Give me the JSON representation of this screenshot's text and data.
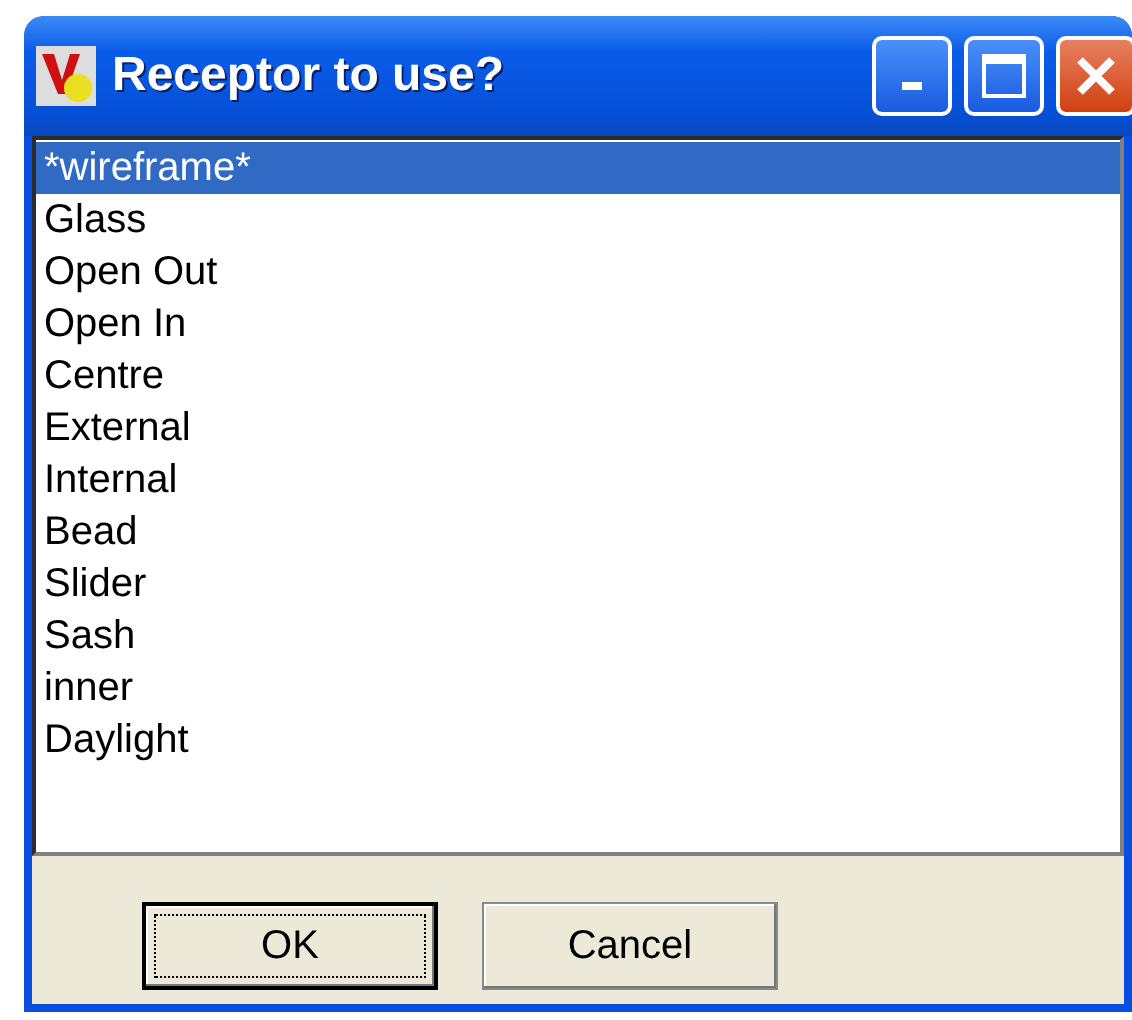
{
  "window": {
    "title": "Receptor to use?"
  },
  "list": {
    "items": [
      {
        "label": "*wireframe*",
        "selected": true
      },
      {
        "label": "Glass",
        "selected": false
      },
      {
        "label": "Open Out",
        "selected": false
      },
      {
        "label": "Open In",
        "selected": false
      },
      {
        "label": "Centre",
        "selected": false
      },
      {
        "label": "External",
        "selected": false
      },
      {
        "label": "Internal",
        "selected": false
      },
      {
        "label": "Bead",
        "selected": false
      },
      {
        "label": "Slider",
        "selected": false
      },
      {
        "label": "Sash",
        "selected": false
      },
      {
        "label": "inner",
        "selected": false
      },
      {
        "label": "Daylight",
        "selected": false
      }
    ]
  },
  "buttons": [
    {
      "label": "OK",
      "focused": true
    },
    {
      "label": "Cancel",
      "focused": false
    }
  ]
}
